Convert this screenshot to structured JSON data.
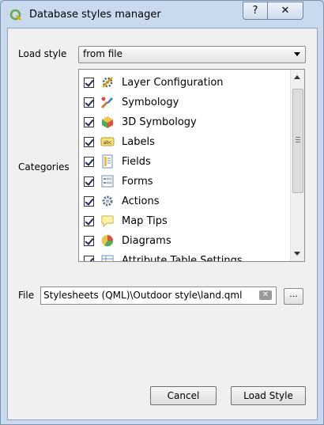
{
  "window": {
    "title": "Database styles manager",
    "help_label": "?",
    "close_label": "✕"
  },
  "load_style": {
    "label": "Load style",
    "selected": "from file"
  },
  "categories": {
    "label": "Categories",
    "items": [
      {
        "label": "Layer Configuration",
        "checked": true,
        "icon": "layer-configuration-icon"
      },
      {
        "label": "Symbology",
        "checked": true,
        "icon": "symbology-icon"
      },
      {
        "label": "3D Symbology",
        "checked": true,
        "icon": "3d-symbology-icon"
      },
      {
        "label": "Labels",
        "checked": true,
        "icon": "labels-icon"
      },
      {
        "label": "Fields",
        "checked": true,
        "icon": "fields-icon"
      },
      {
        "label": "Forms",
        "checked": true,
        "icon": "forms-icon"
      },
      {
        "label": "Actions",
        "checked": true,
        "icon": "actions-icon"
      },
      {
        "label": "Map Tips",
        "checked": true,
        "icon": "map-tips-icon"
      },
      {
        "label": "Diagrams",
        "checked": true,
        "icon": "diagrams-icon"
      },
      {
        "label": "Attribute Table Settings",
        "checked": true,
        "icon": "attribute-table-icon"
      }
    ]
  },
  "file": {
    "label": "File",
    "value": "Stylesheets (QML)\\Outdoor style\\land.qml",
    "browse_label": "..."
  },
  "buttons": {
    "cancel": "Cancel",
    "load_style": "Load Style"
  }
}
